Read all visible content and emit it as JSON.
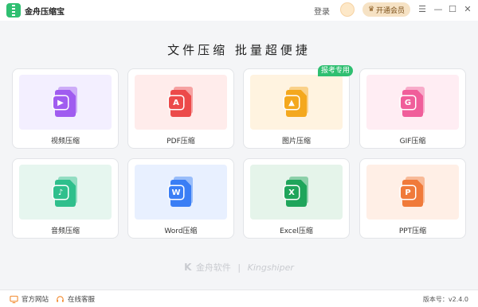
{
  "titlebar": {
    "app_name": "金舟压缩宝",
    "login_label": "登录",
    "vip_label": "开通会员",
    "controls": [
      "☰",
      "—",
      "☐",
      "✕"
    ]
  },
  "heading": "文件压缩  批量超便捷",
  "ribbon": "报考专用",
  "cards": [
    {
      "label": "视频压缩",
      "glyph": "▶",
      "accent": "#a05cf0",
      "panel": "#f3efff",
      "icon": "video-file-icon"
    },
    {
      "label": "PDF压缩",
      "glyph": "A",
      "accent": "#ec4a4a",
      "panel": "#ffeceb",
      "icon": "pdf-file-icon"
    },
    {
      "label": "图片压缩",
      "glyph": "▲",
      "accent": "#f4a81e",
      "panel": "#fff3e0",
      "icon": "image-file-icon"
    },
    {
      "label": "GIF压缩",
      "glyph": "G",
      "accent": "#f05e9a",
      "panel": "#ffedf3",
      "icon": "gif-file-icon"
    },
    {
      "label": "音频压缩",
      "glyph": "♪",
      "accent": "#2fbf8c",
      "panel": "#e6f6ef",
      "icon": "audio-file-icon"
    },
    {
      "label": "Word压缩",
      "glyph": "W",
      "accent": "#3a7ef5",
      "panel": "#e8f0ff",
      "icon": "word-file-icon"
    },
    {
      "label": "Excel压缩",
      "glyph": "X",
      "accent": "#1fa55b",
      "panel": "#e5f4ea",
      "icon": "excel-file-icon"
    },
    {
      "label": "PPT压缩",
      "glyph": "P",
      "accent": "#f07a3a",
      "panel": "#ffefe6",
      "icon": "ppt-file-icon"
    }
  ],
  "brand": {
    "cn": "金舟软件",
    "sep": "|",
    "en": "Kingshiper",
    "k": "K"
  },
  "statusbar": {
    "website": "官方网站",
    "service": "在线客服",
    "version": "版本号：v2.4.0"
  }
}
